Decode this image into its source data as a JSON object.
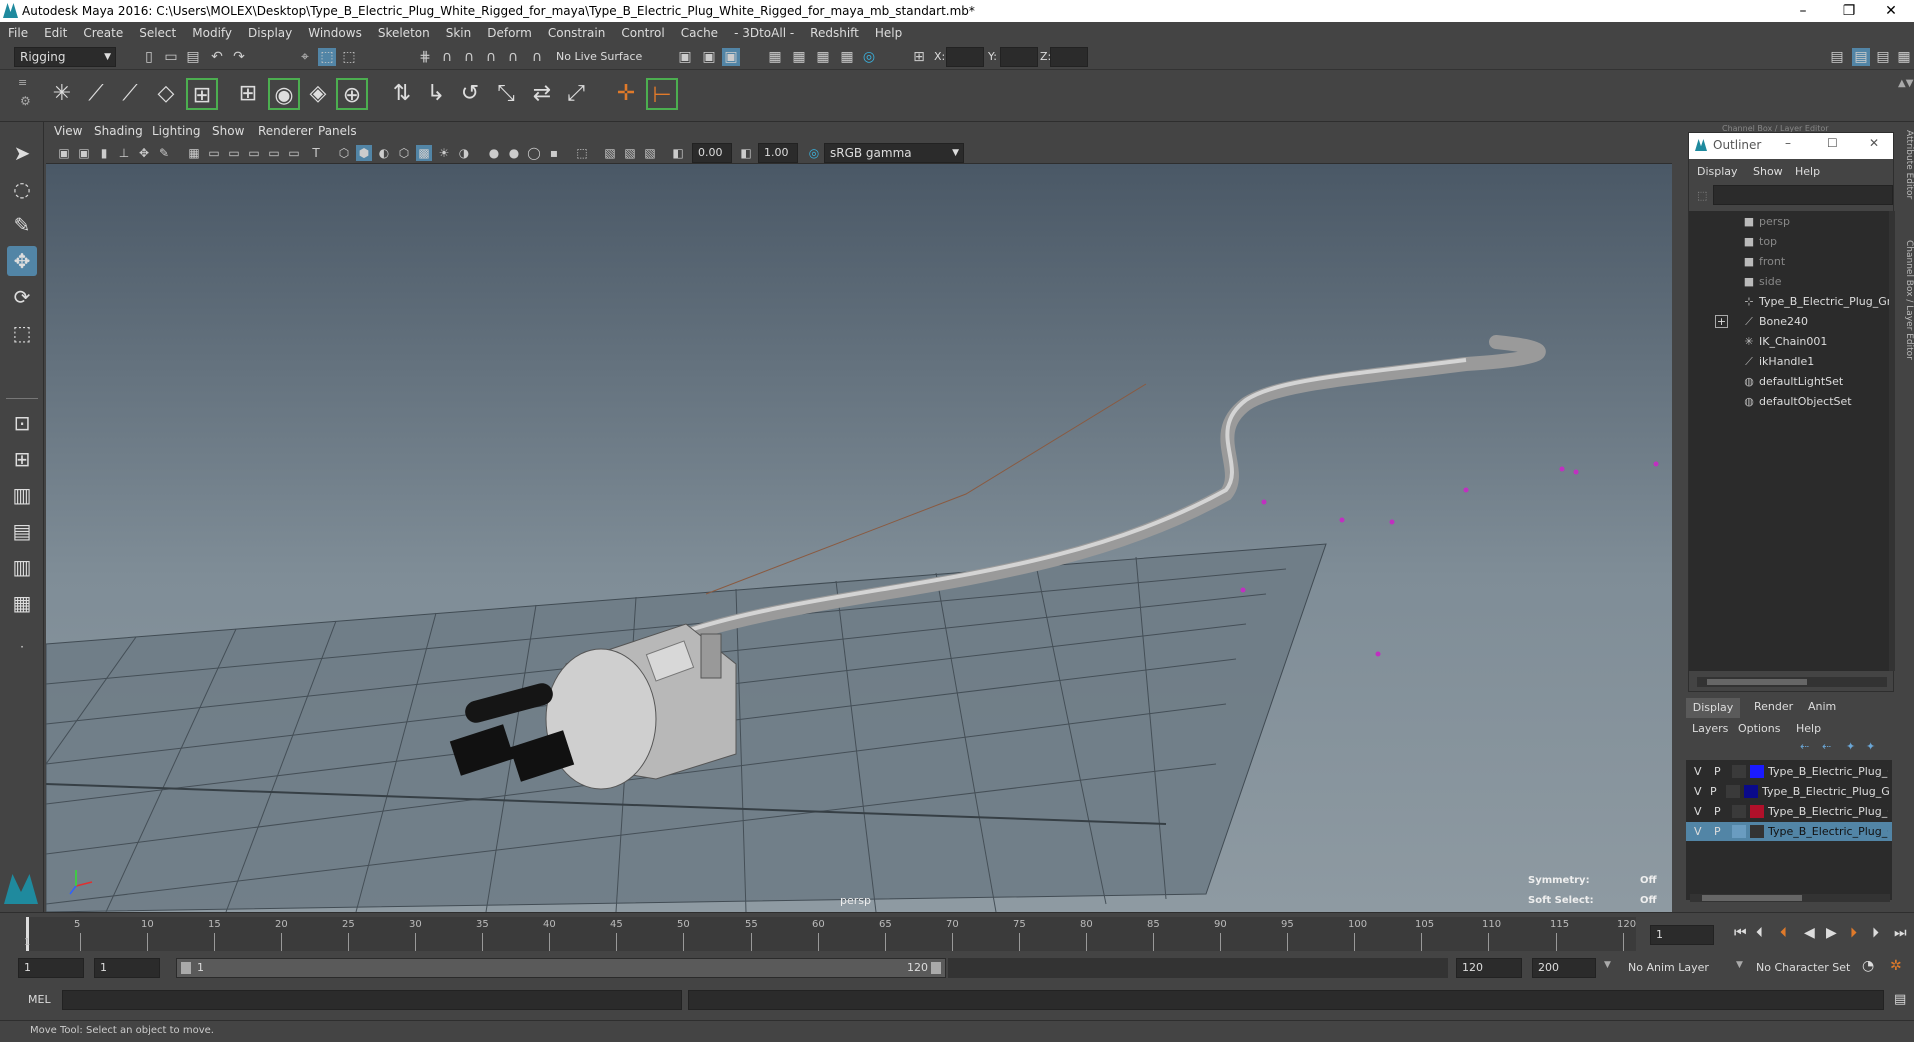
{
  "window": {
    "title": "Autodesk Maya 2016: C:\\Users\\MOLEX\\Desktop\\Type_B_Electric_Plug_White_Rigged_for_maya\\Type_B_Electric_Plug_White_Rigged_for_maya_mb_standart.mb*",
    "controls": {
      "minimize": "–",
      "restore": "❐",
      "close": "✕"
    }
  },
  "menubar": [
    "File",
    "Edit",
    "Create",
    "Select",
    "Modify",
    "Display",
    "Windows",
    "Skeleton",
    "Skin",
    "Deform",
    "Constrain",
    "Control",
    "Cache",
    "- 3DtoAll -",
    "Redshift",
    "Help"
  ],
  "statusline": {
    "mode": "Rigging",
    "live_surface": "No Live Surface",
    "coord_x": "X:",
    "coord_y": "Y:",
    "coord_z": "Z:"
  },
  "viewport_menu": [
    "View",
    "Shading",
    "Lighting",
    "Show",
    "Renderer",
    "Panels"
  ],
  "viewport_toolbar": {
    "value_a": "0.00",
    "value_b": "1.00",
    "color_space": "sRGB gamma"
  },
  "viewport": {
    "camera_label": "persp",
    "symmetry_label": "Symmetry:",
    "symmetry_value": "Off",
    "soft_select_label": "Soft Select:",
    "soft_select_value": "Off"
  },
  "outliner": {
    "title": "Outliner",
    "menu": [
      "Display",
      "Show",
      "Help"
    ],
    "items": [
      {
        "label": "persp",
        "icon": "camera-icon",
        "dim": true
      },
      {
        "label": "top",
        "icon": "camera-icon",
        "dim": true
      },
      {
        "label": "front",
        "icon": "camera-icon",
        "dim": true
      },
      {
        "label": "side",
        "icon": "camera-icon",
        "dim": true
      },
      {
        "label": "Type_B_Electric_Plug_Grou",
        "icon": "group-icon",
        "dim": false
      },
      {
        "label": "Bone240",
        "icon": "joint-icon",
        "dim": false,
        "expandable": true
      },
      {
        "label": "IK_Chain001",
        "icon": "ik-chain-icon",
        "dim": false
      },
      {
        "label": "ikHandle1",
        "icon": "ik-handle-icon",
        "dim": false
      },
      {
        "label": "defaultLightSet",
        "icon": "set-icon",
        "dim": false
      },
      {
        "label": "defaultObjectSet",
        "icon": "set-icon",
        "dim": false
      }
    ]
  },
  "side_tabs": {
    "channel_box": "Channel Box / Layer Editor",
    "attribute_editor": "Attribute Editor",
    "panel_header": "Channel Box / Layer Editor"
  },
  "layer_editor": {
    "tabs": [
      "Display",
      "Render",
      "Anim"
    ],
    "menu": [
      "Layers",
      "Options",
      "Help"
    ],
    "layers": [
      {
        "v": "V",
        "p": "P",
        "color": "#1a1aff",
        "name": "Type_B_Electric_Plug_C",
        "selected": false
      },
      {
        "v": "V",
        "p": "P",
        "color": "#0a0a8a",
        "name": "Type_B_Electric_Plug_Gro",
        "selected": false
      },
      {
        "v": "V",
        "p": "P",
        "color": "#b0102a",
        "name": "Type_B_Electric_Plug_C",
        "selected": false
      },
      {
        "v": "V",
        "p": "P",
        "color": "#5a8ab0",
        "name": "Type_B_Electric_Plug_C",
        "selected": true
      }
    ]
  },
  "timeline": {
    "ticks": [
      "5",
      "10",
      "15",
      "20",
      "25",
      "30",
      "35",
      "40",
      "45",
      "50",
      "55",
      "60",
      "65",
      "70",
      "75",
      "80",
      "85",
      "90",
      "95",
      "100",
      "105",
      "110",
      "115",
      "120"
    ],
    "start_label": "1",
    "current_frame": "1"
  },
  "range": {
    "start": "1",
    "playback_start": "1",
    "slider_start": "1",
    "slider_end": "120",
    "playback_end": "120",
    "end": "200",
    "anim_layer": "No Anim Layer",
    "character_set": "No Character Set"
  },
  "command_line": {
    "label": "MEL"
  },
  "help_line": "Move Tool: Select an object to move.",
  "colors": {
    "accent": "#5285a6",
    "bg": "#444444",
    "field": "#2b2b2b"
  }
}
